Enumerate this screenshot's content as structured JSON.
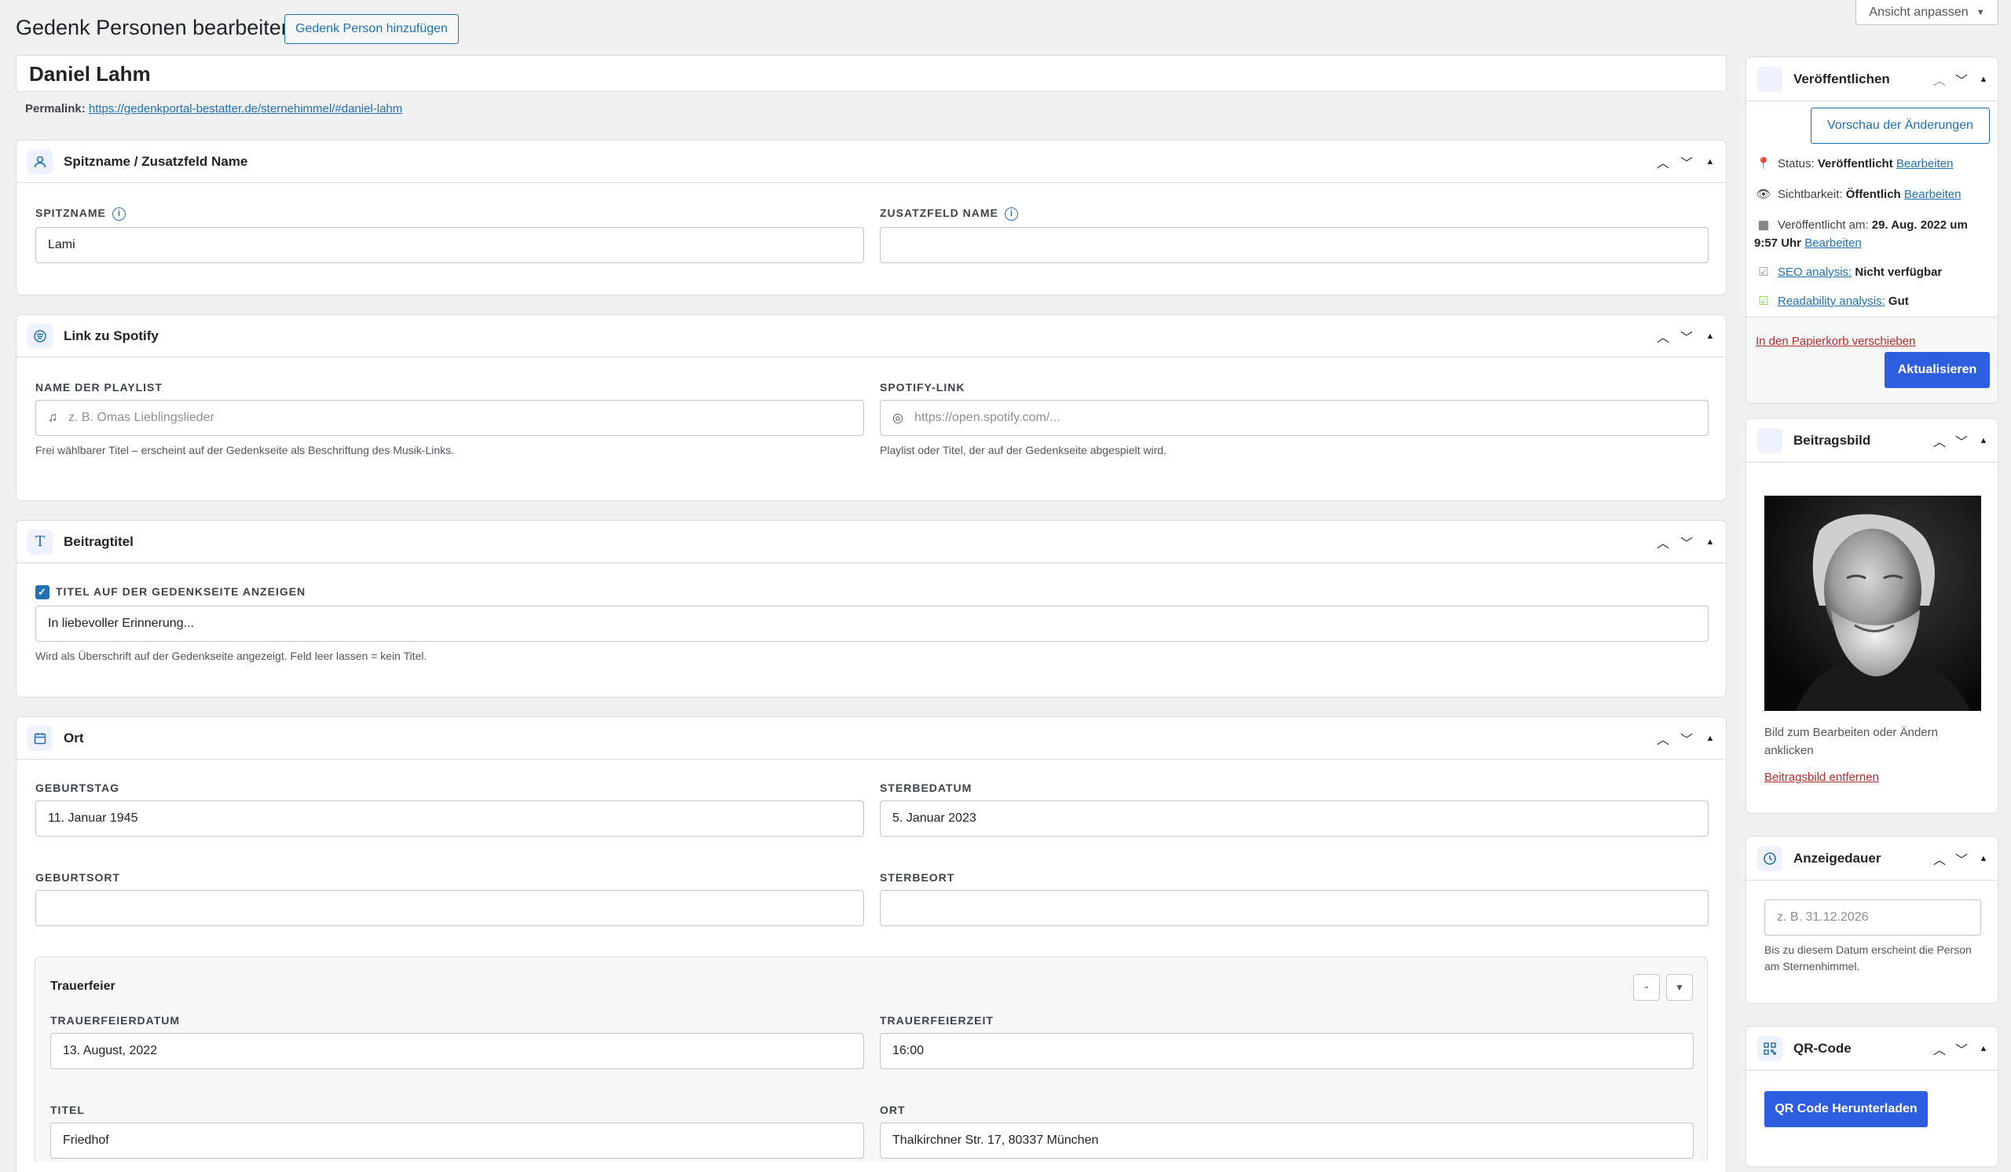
{
  "header": {
    "title": "Gedenk Personen bearbeiten",
    "add_button": "Gedenk Person hinzufügen",
    "screen_options": "Ansicht anpassen",
    "screen_options_arrow": "▼"
  },
  "post": {
    "title": "Daniel Lahm",
    "permalink_label": "Permalink:",
    "permalink_url": "https://gedenkportal-bestatter.de/sternehimmel/#daniel-lahm"
  },
  "sections": {
    "nickname": {
      "title": "Spitzname / Zusatzfeld Name",
      "nickname_label": "SPITZNAME",
      "nickname_value": "Lami",
      "extra_label": "ZUSATZFELD NAME",
      "extra_value": ""
    },
    "spotify": {
      "title": "Link zu Spotify",
      "playlist_label": "NAME DER PLAYLIST",
      "playlist_placeholder": "z. B. Omas Lieblingslieder",
      "playlist_help": "Frei wählbarer Titel – erscheint auf der Gedenkseite als Beschriftung des Musik-Links.",
      "link_label": "SPOTIFY-LINK",
      "link_placeholder": "https://open.spotify.com/...",
      "link_help": "Playlist oder Titel, der auf der Gedenkseite abgespielt wird."
    },
    "post_title": {
      "title": "Beitragtitel",
      "checkbox_label": "TITEL AUF DER GEDENKSEITE ANZEIGEN",
      "checked": true,
      "value": "In liebevoller Erinnerung...",
      "help": "Wird als Überschrift auf der Gedenkseite angezeigt. Feld leer lassen = kein Titel."
    },
    "place": {
      "title": "Ort",
      "birthday_label": "GEBURTSTAG",
      "birthday_value": "11. Januar 1945",
      "deathdate_label": "STERBEDATUM",
      "deathdate_value": "5. Januar 2023",
      "birthplace_label": "GEBURTSORT",
      "birthplace_value": "",
      "deathplace_label": "STERBEORT",
      "deathplace_value": "",
      "funeral": {
        "title": "Trauerfeier",
        "remove_label": "-",
        "toggle_label": "▼",
        "date_label": "TRAUERFEIERDATUM",
        "date_value": "13. August, 2022",
        "time_label": "TRAUERFEIERZEIT",
        "time_value": "16:00",
        "title_label": "TITEL",
        "title_value": "Friedhof",
        "location_label": "ORT",
        "location_value": "Thalkirchner Str. 17, 80337 München"
      }
    }
  },
  "sidebar": {
    "publish": {
      "title": "Veröffentlichen",
      "preview_button": "Vorschau der Änderungen",
      "status_label": "Status:",
      "status_value": "Veröffentlicht",
      "visibility_label": "Sichtbarkeit:",
      "visibility_value": "Öffentlich",
      "published_label": "Veröffentlicht am:",
      "published_value": "29. Aug. 2022 um 9:57 Uhr",
      "edit_link": "Bearbeiten",
      "seo_label": "SEO analysis:",
      "seo_value": "Nicht verfügbar",
      "readability_label": "Readability analysis:",
      "readability_value": "Gut",
      "trash_link": "In den Papierkorb verschieben",
      "update_button": "Aktualisieren"
    },
    "featured_image": {
      "title": "Beitragsbild",
      "hint": "Bild zum Bearbeiten oder Ändern anklicken",
      "remove_link": "Beitragsbild entfernen"
    },
    "display_duration": {
      "title": "Anzeigedauer",
      "placeholder": "z. B. 31.12.2026",
      "help": "Bis zu diesem Datum erscheint die Person am Sternenhimmel."
    },
    "qr": {
      "title": "QR-Code",
      "download_button": "QR Code Herunterladen"
    }
  },
  "colors": {
    "accent": "#2271b1",
    "primary_button": "#2e5ee0",
    "danger": "#b32d2e",
    "background": "#f0f0f1"
  }
}
